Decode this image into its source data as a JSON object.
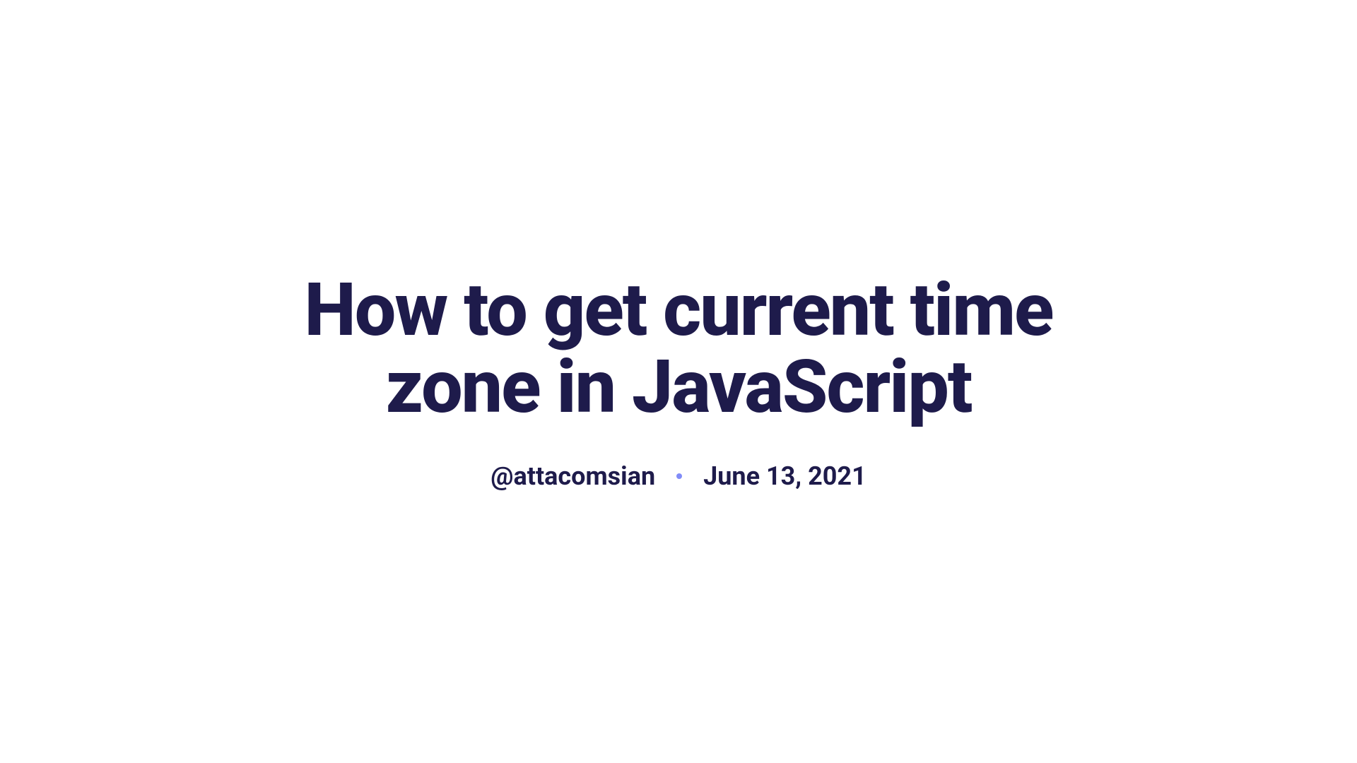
{
  "article": {
    "title": "How to get current time zone in JavaScript",
    "author": "@attacomsian",
    "date": "June 13, 2021"
  }
}
